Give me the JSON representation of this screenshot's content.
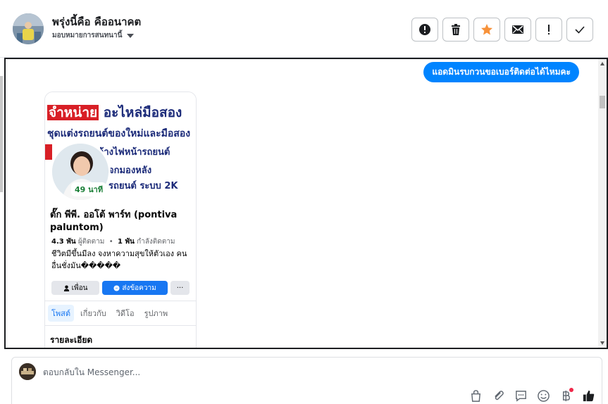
{
  "header": {
    "contact_name": "พรุ่งนี้คือ คืออนาคต",
    "assign_label": "มอบหมายการสนทนานี้",
    "actions": [
      {
        "icon": "alert-circle-icon",
        "name": "spam-button"
      },
      {
        "icon": "trash-icon",
        "name": "delete-button"
      },
      {
        "icon": "star-icon",
        "name": "star-button",
        "color": "#f7923a"
      },
      {
        "icon": "envelope-icon",
        "name": "mark-unread-button"
      },
      {
        "icon": "exclamation-icon",
        "name": "follow-up-button"
      },
      {
        "icon": "check-icon",
        "name": "mark-done-button"
      }
    ]
  },
  "conversation": {
    "outgoing_message": "แอดมินรบกวนขอเบอร์ติดต่อได้ไหมคะ",
    "attachment": {
      "cover_line1_red": "จำหน่าย",
      "cover_line1_rest": "อะไหล่มือสอง",
      "cover_line2": "ชุดแต่งรถยนต์ของใหม่และมือสอง",
      "cover_line3": "-ล้างไฟหน้ารถยนต์",
      "cover_line4": "จกมองหลัง",
      "cover_line5": "รถยนต์ ระบบ 2K",
      "story_badge": "49 นาที",
      "profile_name": "ตั๊ก พีพี. ออโต้ พาร์ท (pontiva paluntom)",
      "followers_count": "4.3 พัน",
      "followers_label": "ผู้ติดตาม",
      "following_count": "1 พัน",
      "following_label": "กำลังติดตาม",
      "bio": "ชีวิตมีขึ้นมีลง จงหาความสุขให้ตัวเอง คนอื่นชั่งมัน�����",
      "buttons": {
        "friend": "เพื่อน",
        "message": "ส่งข้อความ",
        "more": "···"
      },
      "tabs": [
        "โพสต์",
        "เกี่ยวกับ",
        "วิดีโอ",
        "รูปภาพ"
      ],
      "details_heading": "รายละเอียด"
    }
  },
  "composer": {
    "placeholder": "ตอบกลับใน Messenger...",
    "tools": [
      "shopping-bag-icon",
      "paperclip-icon",
      "saved-reply-icon",
      "emoji-icon",
      "baht-icon",
      "like-icon"
    ]
  },
  "colors": {
    "accent": "#0084ff",
    "facebook_blue": "#1877f2",
    "star": "#f7923a",
    "notification": "#f02849"
  }
}
